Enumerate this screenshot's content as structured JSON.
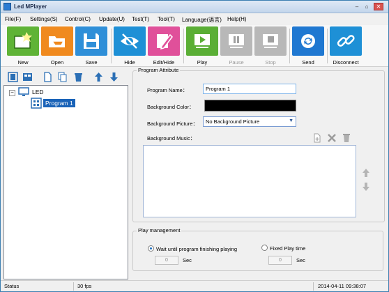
{
  "window": {
    "title": "Led MPlayer"
  },
  "menu": [
    "File(F)",
    "Settings(S)",
    "Control(C)",
    "Update(U)",
    "Test(T)",
    "Tool(T)",
    "Language(语言)",
    "Help(H)"
  ],
  "toolbar": {
    "new": "New",
    "open": "Open",
    "save": "Save",
    "hide": "Hide",
    "edit_hide": "Edit/Hide",
    "play": "Play",
    "pause": "Pause",
    "stop": "Stop",
    "send": "Send",
    "disconnect": "Disconnect"
  },
  "tree": {
    "root": "LED",
    "program": "Program 1",
    "expander": "−"
  },
  "program_attribute": {
    "title": "Program Attribute",
    "name_label": "Program Name：",
    "name_value": "Program 1",
    "bg_color_label": "Background Color：",
    "bg_color_value": "#000000",
    "bg_picture_label": "Background Picture：",
    "bg_picture_value": "No Background Picture",
    "bg_music_label": "Background Music："
  },
  "play_management": {
    "title": "Play management",
    "option_wait": "Wait until program finishing playing",
    "option_fixed": "Fixed Play time",
    "wait_value": "0",
    "fixed_value": "0",
    "unit": "Sec",
    "selected": "wait"
  },
  "status": {
    "label": "Status",
    "fps": "30 fps",
    "datetime": "2014-04-11 09:38:07"
  },
  "colors": {
    "new": "#5fb336",
    "open": "#f08a1e",
    "save": "#2f8fd8",
    "hide": "#1e90d6",
    "edit": "#e0509a",
    "play": "#5aae35",
    "disabled": "#9a9a9a",
    "send": "#1f78d1",
    "disconnect": "#1e90d6"
  }
}
